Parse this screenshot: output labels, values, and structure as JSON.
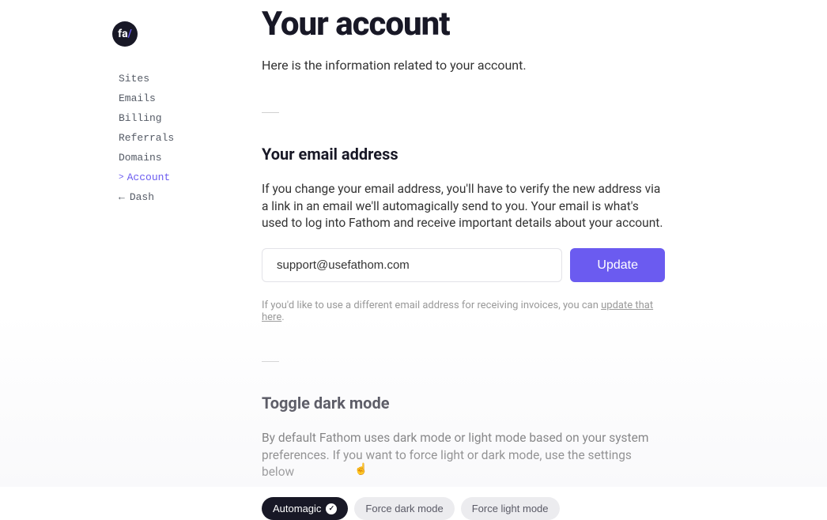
{
  "logo": {
    "text_a": "fa",
    "text_b": "/"
  },
  "sidebar": {
    "items": [
      {
        "label": "Sites"
      },
      {
        "label": "Emails"
      },
      {
        "label": "Billing"
      },
      {
        "label": "Referrals"
      },
      {
        "label": "Domains"
      },
      {
        "label": "Account"
      },
      {
        "label": "Dash"
      }
    ]
  },
  "header": {
    "title": "Your account",
    "subtitle": "Here is the information related to your account."
  },
  "email_section": {
    "title": "Your email address",
    "desc": "If you change your email address, you'll have to verify the new address via a link in an email we'll automagically send to you. Your email is what's used to log into Fathom and receive important details about your account.",
    "input_value": "support@usefathom.com",
    "update_label": "Update",
    "help_prefix": "If you'd like to use a different email address for receiving invoices, you can ",
    "help_link": "update that here",
    "help_suffix": "."
  },
  "darkmode_section": {
    "title": "Toggle dark mode",
    "desc": "By default Fathom uses dark mode or light mode based on your system preferences. If you want to force light or dark mode, use the settings below",
    "options": [
      {
        "label": "Automagic"
      },
      {
        "label": "Force dark mode"
      },
      {
        "label": "Force light mode"
      }
    ]
  }
}
